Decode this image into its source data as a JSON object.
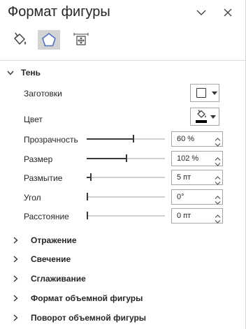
{
  "pane": {
    "title": "Формат фигуры"
  },
  "sections": {
    "shadow": {
      "title": "Тень",
      "presets_label": "Заготовки",
      "color_label": "Цвет",
      "rows": [
        {
          "label": "Прозрачность",
          "value": "60 %",
          "level": 0.6
        },
        {
          "label": "Размер",
          "value": "102 %",
          "level": 0.51
        },
        {
          "label": "Размытие",
          "value": "5 пт",
          "level": 0.05
        },
        {
          "label": "Угол",
          "value": "0°",
          "level": 0.0
        },
        {
          "label": "Расстояние",
          "value": "0 пт",
          "level": 0.0
        }
      ]
    },
    "collapsed": [
      "Отражение",
      "Свечение",
      "Сглаживание",
      "Формат объемной фигуры",
      "Поворот объемной фигуры"
    ]
  },
  "icons": {
    "chevron_down": "chevron-down-icon",
    "close": "close-icon",
    "fill_line": "paint-bucket-icon",
    "effects": "pentagon-icon",
    "size_props": "size-properties-icon"
  },
  "colors": {
    "accent": "#4a72c4",
    "active_tab_bg": "#d3d3d3",
    "shadow_color": "#000000"
  }
}
